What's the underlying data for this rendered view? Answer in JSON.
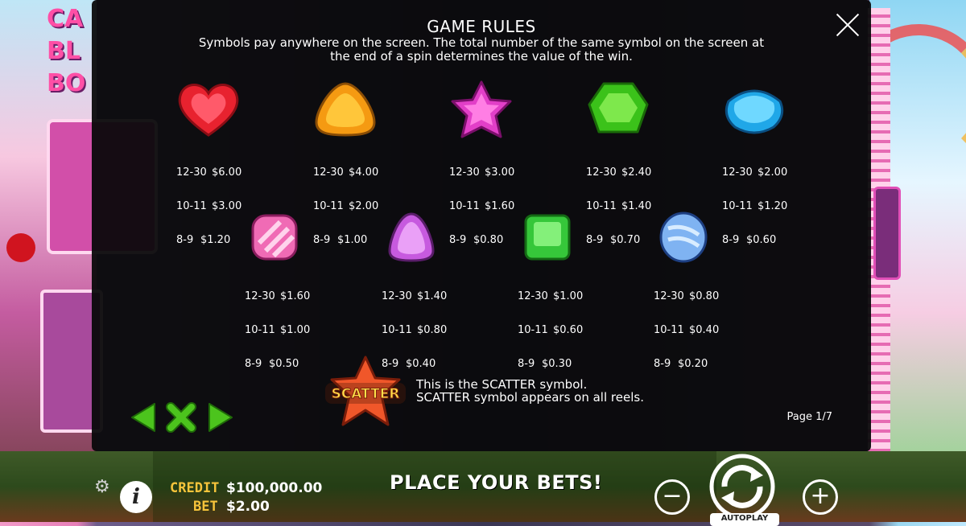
{
  "background": {
    "logo_text": "CA\nBL\nBO"
  },
  "modal": {
    "title": "GAME RULES",
    "description": "Symbols pay anywhere on the screen. The total number of the same symbol on the screen at the end of a spin determines the value of the win.",
    "symbols": [
      {
        "icon": "red-heart-candy-icon",
        "color": "#e8222f",
        "pays": [
          [
            "12-30",
            "$6.00"
          ],
          [
            "10-11",
            "$3.00"
          ],
          [
            "8-9",
            "$1.20"
          ]
        ]
      },
      {
        "icon": "orange-triangle-candy-icon",
        "color": "#f59a12",
        "pays": [
          [
            "12-30",
            "$4.00"
          ],
          [
            "10-11",
            "$2.00"
          ],
          [
            "8-9",
            "$1.00"
          ]
        ]
      },
      {
        "icon": "pink-star-candy-icon",
        "color": "#e23fc8",
        "pays": [
          [
            "12-30",
            "$3.00"
          ],
          [
            "10-11",
            "$1.60"
          ],
          [
            "8-9",
            "$0.80"
          ]
        ]
      },
      {
        "icon": "green-hexagon-candy-icon",
        "color": "#3bc21a",
        "pays": [
          [
            "12-30",
            "$2.40"
          ],
          [
            "10-11",
            "$1.40"
          ],
          [
            "8-9",
            "$0.70"
          ]
        ]
      },
      {
        "icon": "blue-square-candy-icon",
        "color": "#20a7e8",
        "pays": [
          [
            "12-30",
            "$2.00"
          ],
          [
            "10-11",
            "$1.20"
          ],
          [
            "8-9",
            "$0.60"
          ]
        ]
      },
      {
        "icon": "pink-striped-candy-icon",
        "color": "#f06bb5",
        "pays": [
          [
            "12-30",
            "$1.60"
          ],
          [
            "10-11",
            "$1.00"
          ],
          [
            "8-9",
            "$0.50"
          ]
        ]
      },
      {
        "icon": "purple-gumdrop-candy-icon",
        "color": "#c75adf",
        "pays": [
          [
            "12-30",
            "$1.40"
          ],
          [
            "10-11",
            "$0.80"
          ],
          [
            "8-9",
            "$0.40"
          ]
        ]
      },
      {
        "icon": "green-square-candy-icon",
        "color": "#36c73a",
        "pays": [
          [
            "12-30",
            "$1.00"
          ],
          [
            "10-11",
            "$0.60"
          ],
          [
            "8-9",
            "$0.30"
          ]
        ]
      },
      {
        "icon": "blue-oval-candy-icon",
        "color": "#7fb3f2",
        "pays": [
          [
            "12-30",
            "$0.80"
          ],
          [
            "10-11",
            "$0.40"
          ],
          [
            "8-9",
            "$0.20"
          ]
        ]
      }
    ],
    "scatter": {
      "badge": "SCATTER",
      "line1": "This is the SCATTER symbol.",
      "line2": "SCATTER symbol appears on all reels."
    },
    "page": "Page 1/7"
  },
  "bottom": {
    "credit_label": "CREDIT",
    "credit_value": "$100,000.00",
    "bet_label": "BET",
    "bet_value": "$2.00",
    "status": "PLACE YOUR BETS!",
    "minus": "−",
    "plus": "+",
    "autoplay": "AUTOPLAY",
    "info": "i"
  },
  "colors": {
    "accent_gold": "#f7c43b",
    "nav_green": "#4cc41d",
    "modal_bg": "#08080a"
  }
}
